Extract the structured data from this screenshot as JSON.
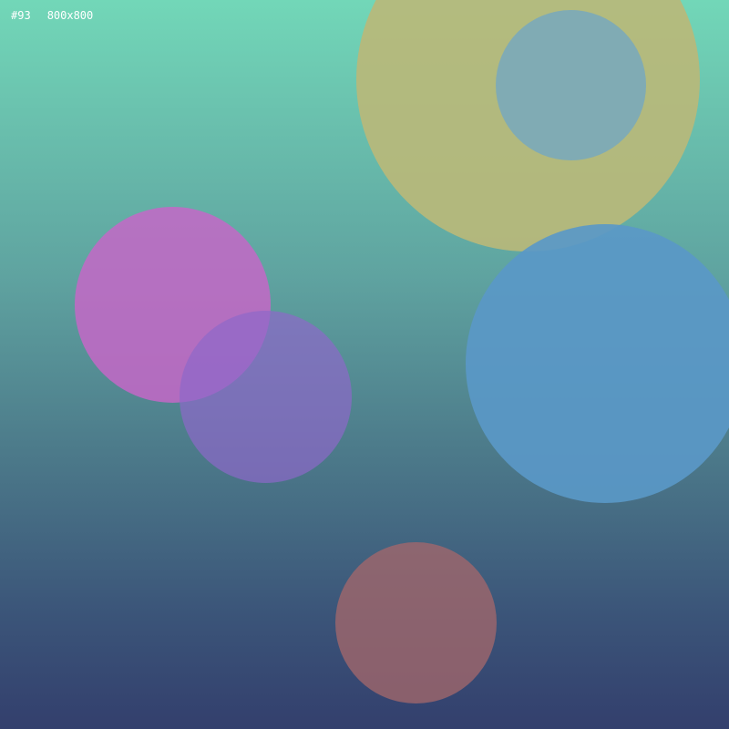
{
  "label": {
    "index": "#93",
    "size": "800x800"
  },
  "circles": [
    {
      "name": "large-olive-circle",
      "color": "#b8b97a"
    },
    {
      "name": "small-steel-circle",
      "color": "#7daab7"
    },
    {
      "name": "blue-circle",
      "color": "#5a98c7"
    },
    {
      "name": "magenta-circle",
      "color": "#c467c7"
    },
    {
      "name": "purple-circle",
      "color": "#8d68c9"
    },
    {
      "name": "brown-circle",
      "color": "#a0666c"
    }
  ]
}
